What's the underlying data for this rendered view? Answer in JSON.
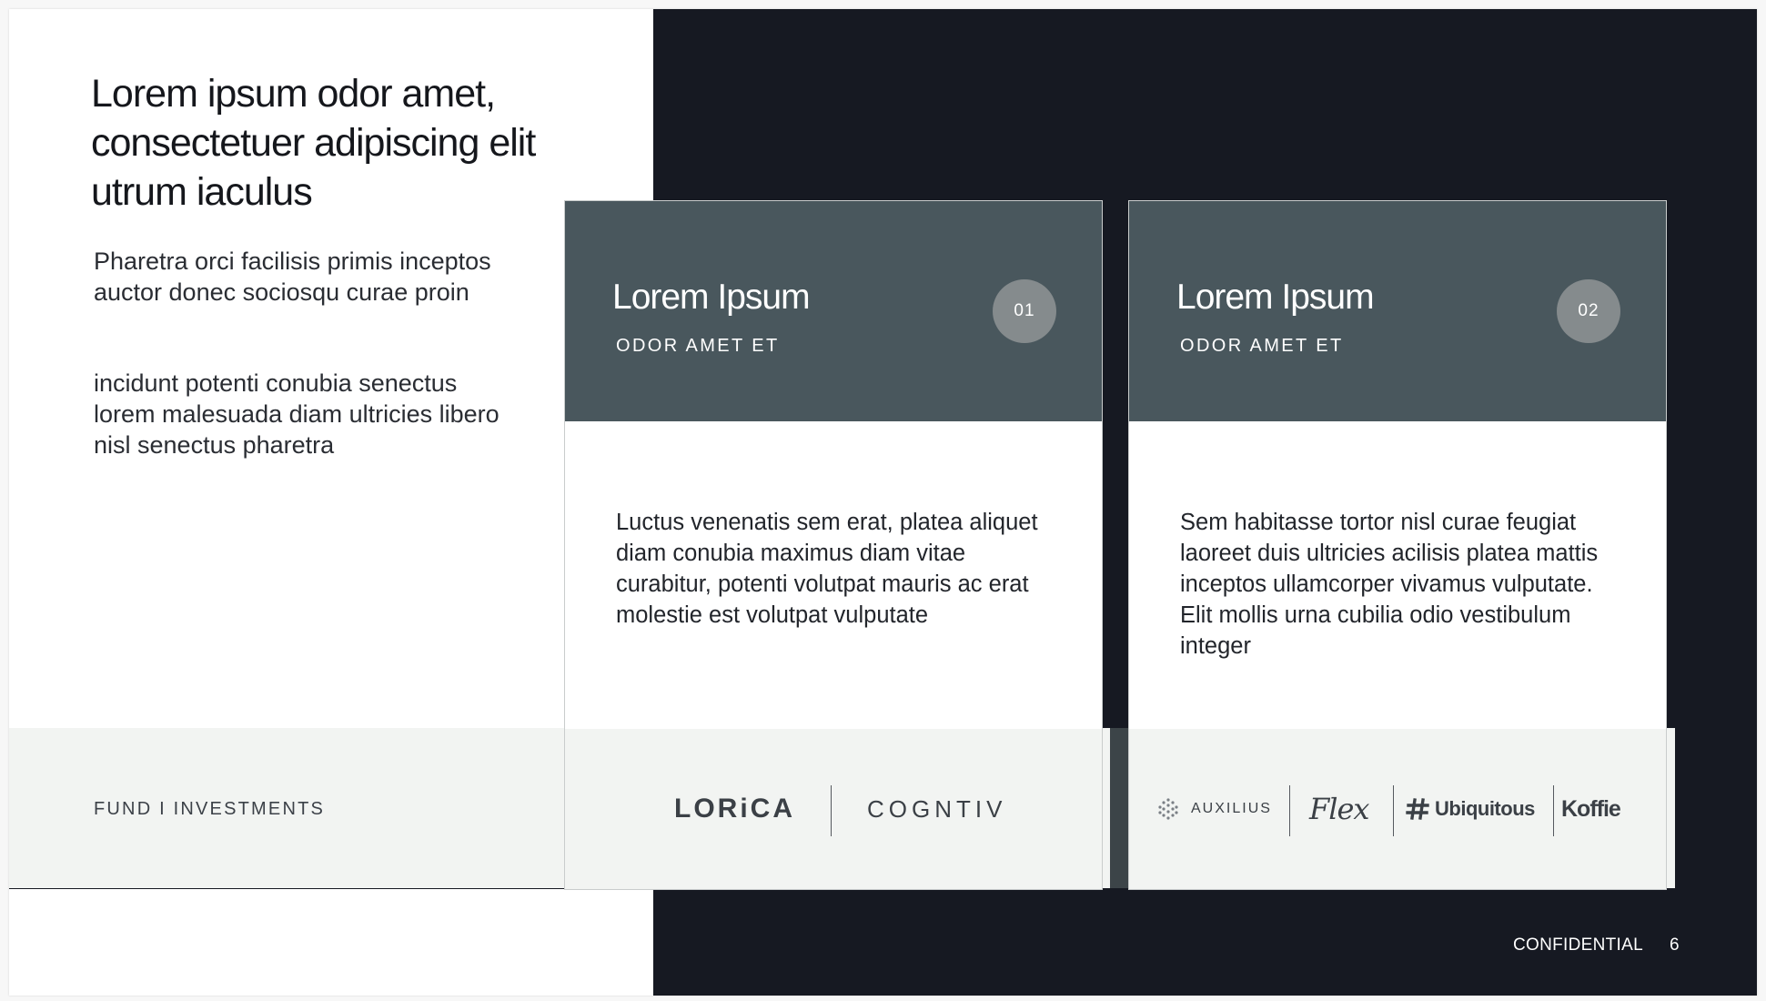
{
  "slide": {
    "title": "Lorem ipsum odor amet, consectetuer adipiscing elit utrum iaculus",
    "paragraphs": [
      "Pharetra orci facilisis primis inceptos auctor donec sociosqu curae proin",
      "incidunt potenti conubia senectus lorem malesuada diam ultricies libero nisl senectus pharetra"
    ],
    "fund_label": "FUND I INVESTMENTS",
    "footer": {
      "confidential": "CONFIDENTIAL",
      "page_number": "6"
    }
  },
  "cards": [
    {
      "title": "Lorem Ipsum",
      "subtitle": "ODOR AMET ET",
      "number": "01",
      "body": "Luctus venenatis sem erat, platea aliquet diam conubia maximus diam vitae curabitur, potenti volutpat mauris ac erat molestie est volutpat vulputate",
      "logos": [
        "LORiCA",
        "COGNTIV"
      ]
    },
    {
      "title": "Lorem Ipsum",
      "subtitle": "ODOR AMET ET",
      "number": "02",
      "body": "Sem habitasse tortor nisl curae feugiat laoreet duis ultricies acilisis platea mattis inceptos ullamcorper vivamus vulputate. Elit mollis urna cubilia odio vestibulum integer",
      "logos": [
        "AUXILIUS",
        "Flex",
        "Ubiquitous",
        "Koffie"
      ]
    }
  ],
  "colors": {
    "dark_background": "#161922",
    "card_header": "#49575d",
    "number_badge": "#858b8d",
    "light_band": "#f2f4f2",
    "text_dark": "#15171c"
  },
  "icons": {
    "auxilius_logo_mark": "dotted-hexagon-icon",
    "ubiquitous_logo_mark": "hash-icon"
  }
}
